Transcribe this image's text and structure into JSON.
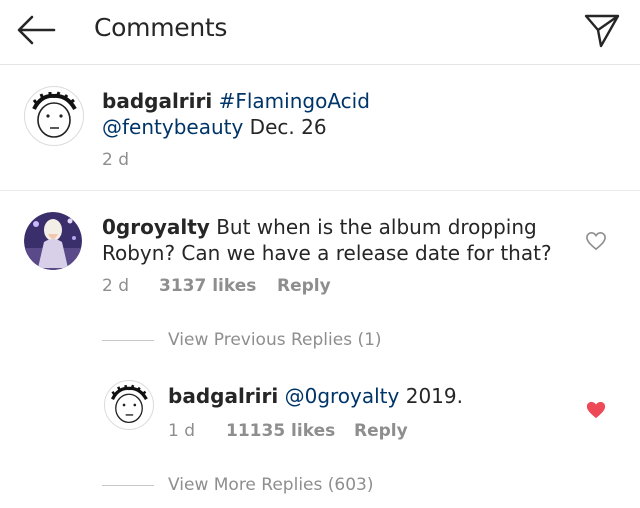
{
  "header": {
    "title": "Comments"
  },
  "caption": {
    "username": "badgalriri",
    "hashtag": "#FlamingoAcid",
    "mention": "@fentybeauty",
    "text_after": "Dec. 26",
    "time": "2 d"
  },
  "comment": {
    "username": "0groyalty",
    "text_line1": "But when is the album dropping",
    "text_line2": "Robyn? Can we have a release date for that?",
    "time": "2 d",
    "likes": "3137 likes",
    "reply_label": "Reply",
    "liked": false,
    "view_previous": "View Previous Replies (1)"
  },
  "reply": {
    "username": "badgalriri",
    "mention": "@0groyalty",
    "text_after": "2019.",
    "time": "1 d",
    "likes": "11135 likes",
    "reply_label": "Reply",
    "liked": true,
    "heart_color": "#ed4956"
  },
  "view_more": "View More Replies (603)"
}
